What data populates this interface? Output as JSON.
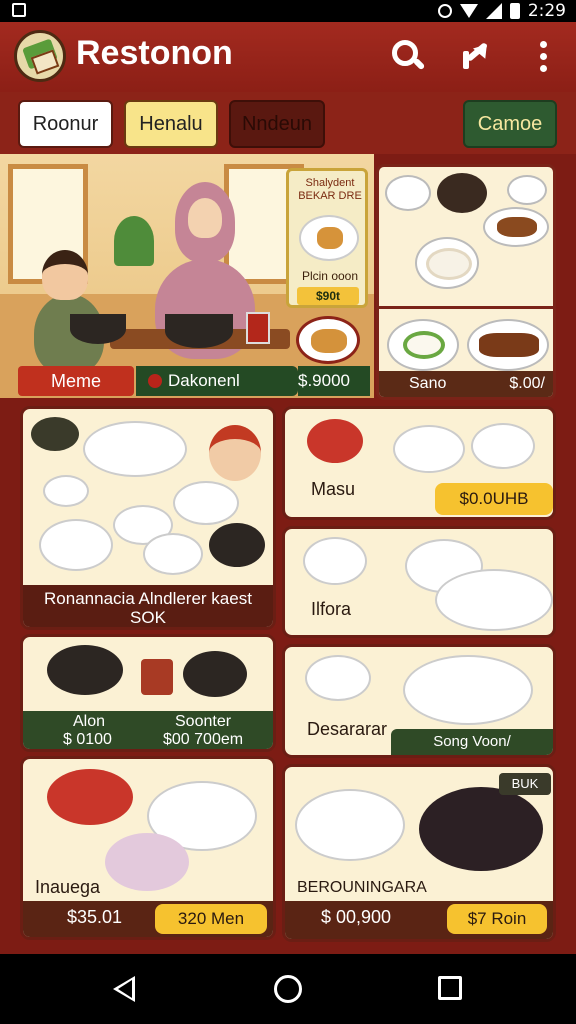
{
  "status_bar": {
    "time": "2:29"
  },
  "app": {
    "title": "Restonon"
  },
  "tabs": [
    "Roonur",
    "Henalu",
    "Nndeun",
    "Camoe"
  ],
  "hero": {
    "menu_label": "Meme",
    "badge_text": "Dakonenl",
    "price": "$.9000",
    "promo_title": "Shalydent BEKAR DRE",
    "promo_sub": "Plcin ooon",
    "promo_price": "$90t"
  },
  "top_right_card": {
    "label": "Sano",
    "price": "$.00/"
  },
  "cards": [
    {
      "label": "Ronannacia Alndlerer kaest",
      "sub": "SOK"
    },
    {
      "label": "Masu",
      "price": "$0.0UHB"
    },
    {
      "label": "Ilfora"
    },
    {
      "label_left": "Alon",
      "price_left": "$ 0100",
      "label_right": "Soonter",
      "price_right": "$00 700em"
    },
    {
      "label": "Desararar",
      "tag": "Song Voon/"
    },
    {
      "label": "Inauega",
      "price": "$35.01",
      "pill": "320 Men"
    },
    {
      "label": "BEROUNINGARA",
      "price": "$ 00,900",
      "pill": "$7 Roin",
      "badge": "BUK"
    }
  ],
  "colors": {
    "appbar": "#a32a1f",
    "background": "#7a1a14",
    "accent_yellow": "#f6c22f",
    "accent_green": "#2f4a26"
  }
}
